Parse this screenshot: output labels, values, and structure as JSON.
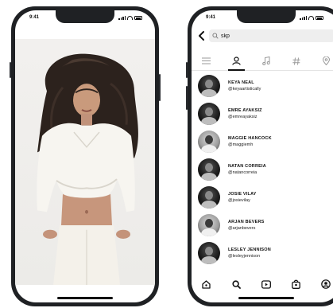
{
  "left_phone": {
    "status_time": "9:41"
  },
  "right_phone": {
    "status_time": "9:41",
    "search": {
      "value": "skp"
    },
    "tabs": [
      {
        "icon": "menu-icon",
        "active": false
      },
      {
        "icon": "person-icon",
        "active": true
      },
      {
        "icon": "music-note-icon",
        "active": false
      },
      {
        "icon": "hashtag-icon",
        "active": false
      },
      {
        "icon": "location-pin-icon",
        "active": false
      }
    ],
    "results": [
      {
        "name": "KEYA NEAL",
        "handle": "@keyaartistically"
      },
      {
        "name": "EMRE AYAKSIZ",
        "handle": "@emreayaksiz"
      },
      {
        "name": "MAGGIE HANCOCK",
        "handle": "@maggiemh"
      },
      {
        "name": "NATAN CORREIA",
        "handle": "@natancorreia"
      },
      {
        "name": "JOSIE VILAY",
        "handle": "@josievilay"
      },
      {
        "name": "ARJAN BEVERS",
        "handle": "@arjanbevers"
      },
      {
        "name": "LESLEY JENNISON",
        "handle": "@lesleyjennison"
      }
    ],
    "bottom_nav": [
      {
        "icon": "home-icon"
      },
      {
        "icon": "search-icon"
      },
      {
        "icon": "video-icon"
      },
      {
        "icon": "bag-icon"
      },
      {
        "icon": "profile-icon"
      }
    ]
  }
}
